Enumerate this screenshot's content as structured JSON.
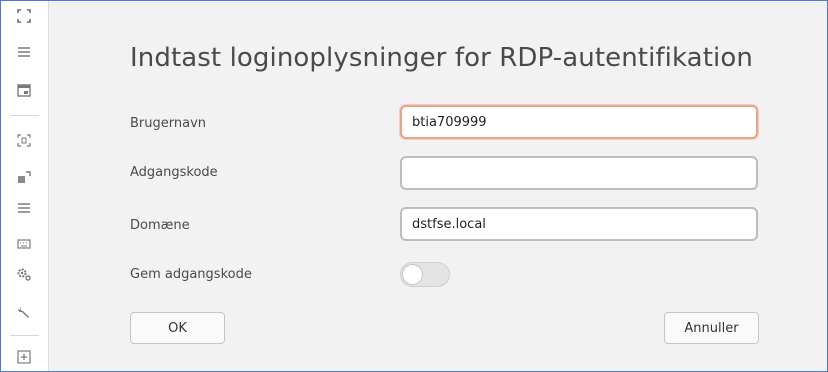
{
  "sidebar": {
    "icons": [
      {
        "name": "fullscreen-icon",
        "glyph": "⛶"
      },
      {
        "name": "menu-icon",
        "glyph": "≡"
      },
      {
        "name": "window-icon",
        "glyph": "▣"
      },
      {
        "name": "fit-screen-icon",
        "glyph": "⛶"
      },
      {
        "name": "expand-icon",
        "glyph": "⤢"
      },
      {
        "name": "list-icon",
        "glyph": "≡"
      },
      {
        "name": "keyboard-icon",
        "glyph": "⌨"
      },
      {
        "name": "gears-icon",
        "glyph": "⚙"
      },
      {
        "name": "wrench-icon",
        "glyph": "🔧"
      },
      {
        "name": "add-window-icon",
        "glyph": "⊞"
      }
    ]
  },
  "dialog": {
    "title": "Indtast loginoplysninger for RDP-autentifikation",
    "username_label": "Brugernavn",
    "username_value": "btia709999",
    "password_label": "Adgangskode",
    "password_value": "",
    "domain_label": "Domæne",
    "domain_value": "dstfse.local",
    "save_password_label": "Gem adgangskode",
    "save_password_on": false,
    "ok_label": "OK",
    "cancel_label": "Annuller"
  },
  "colors": {
    "focus_border": "#e8a48a",
    "frame": "#4a7bd4"
  }
}
